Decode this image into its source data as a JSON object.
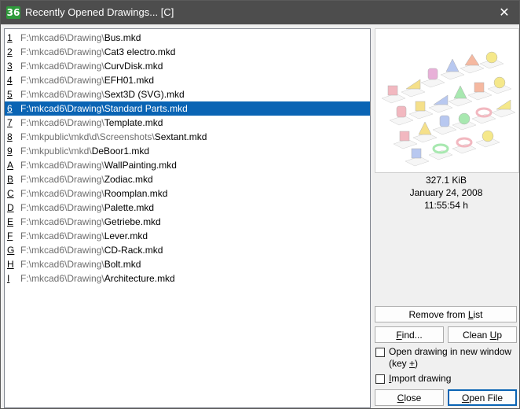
{
  "window": {
    "title": "Recently Opened Drawings... [C]",
    "icon_text": "36"
  },
  "files": [
    {
      "key": "1",
      "path": "F:\\mkcad6\\Drawing\\",
      "name": "Bus.mkd"
    },
    {
      "key": "2",
      "path": "F:\\mkcad6\\Drawing\\",
      "name": "Cat3 electro.mkd"
    },
    {
      "key": "3",
      "path": "F:\\mkcad6\\Drawing\\",
      "name": "CurvDisk.mkd"
    },
    {
      "key": "4",
      "path": "F:\\mkcad6\\Drawing\\",
      "name": "EFH01.mkd"
    },
    {
      "key": "5",
      "path": "F:\\mkcad6\\Drawing\\",
      "name": "Sext3D (SVG).mkd"
    },
    {
      "key": "6",
      "path": "F:\\mkcad6\\Drawing\\",
      "name": "Standard Parts.mkd"
    },
    {
      "key": "7",
      "path": "F:\\mkcad6\\Drawing\\",
      "name": "Template.mkd"
    },
    {
      "key": "8",
      "path": "F:\\mkpublic\\mkd\\d\\Screenshots\\",
      "name": "Sextant.mkd"
    },
    {
      "key": "9",
      "path": "F:\\mkpublic\\mkd\\",
      "name": "DeBoor1.mkd"
    },
    {
      "key": "A",
      "path": "F:\\mkcad6\\Drawing\\",
      "name": "WallPainting.mkd"
    },
    {
      "key": "B",
      "path": "F:\\mkcad6\\Drawing\\",
      "name": "Zodiac.mkd"
    },
    {
      "key": "C",
      "path": "F:\\mkcad6\\Drawing\\",
      "name": "Roomplan.mkd"
    },
    {
      "key": "D",
      "path": "F:\\mkcad6\\Drawing\\",
      "name": "Palette.mkd"
    },
    {
      "key": "E",
      "path": "F:\\mkcad6\\Drawing\\",
      "name": "Getriebe.mkd"
    },
    {
      "key": "F",
      "path": "F:\\mkcad6\\Drawing\\",
      "name": "Lever.mkd"
    },
    {
      "key": "G",
      "path": "F:\\mkcad6\\Drawing\\",
      "name": "CD-Rack.mkd"
    },
    {
      "key": "H",
      "path": "F:\\mkcad6\\Drawing\\",
      "name": "Bolt.mkd"
    },
    {
      "key": "I",
      "path": "F:\\mkcad6\\Drawing\\",
      "name": "Architecture.mkd"
    }
  ],
  "selected_index": 5,
  "info": {
    "size": "327.1 KiB",
    "date": "January 24, 2008",
    "time": "11:55:54 h"
  },
  "buttons": {
    "remove_pre": "Remove from ",
    "remove_ul": "L",
    "remove_post": "ist",
    "find_ul": "F",
    "find_post": "ind...",
    "cleanup_pre": "Clean ",
    "cleanup_ul": "U",
    "cleanup_post": "p",
    "close_ul": "C",
    "close_post": "lose",
    "open_pre": "",
    "open_ul": "O",
    "open_post": "pen File"
  },
  "options": {
    "new_window_line1": "Open drawing in new window",
    "new_window_line2_pre": "(key ",
    "new_window_line2_key": "+",
    "new_window_line2_post": ")",
    "import_pre": "",
    "import_ul": "I",
    "import_post": "mport drawing"
  },
  "colors": {
    "selection": "#0a64b4",
    "titlebar": "#4d4d4d",
    "app_icon": "#2e9a3b"
  },
  "icons": {
    "close": "close-icon",
    "app": "app-icon"
  }
}
